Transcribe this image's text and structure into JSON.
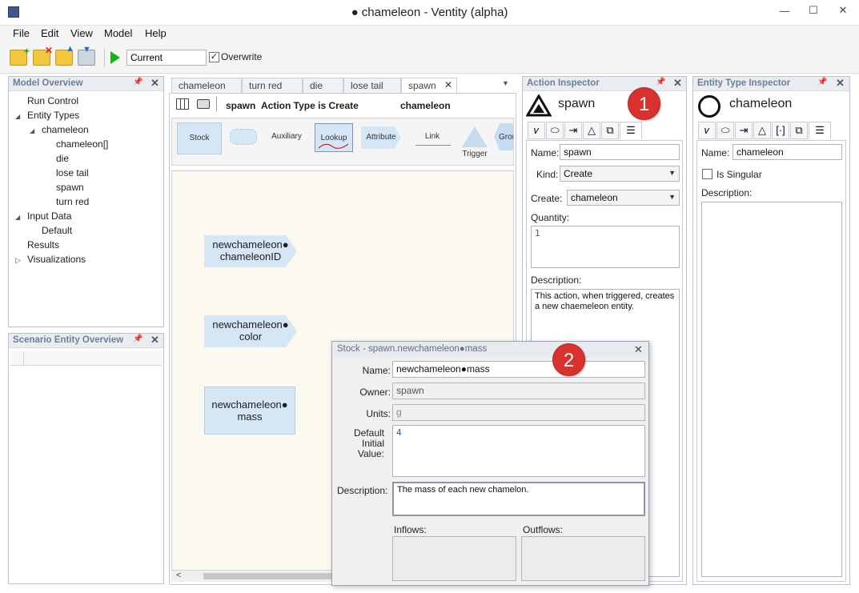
{
  "window": {
    "title": "● chameleon - Ventity (alpha)",
    "min_glyph": "—",
    "max_glyph": "☐",
    "close_glyph": "✕"
  },
  "menu": [
    "File",
    "Edit",
    "View",
    "Model",
    "Help"
  ],
  "toolbar": {
    "scenario_value": "Current",
    "overwrite_label": "Overwrite",
    "overwrite_checked": true
  },
  "model_overview": {
    "title": "Model Overview",
    "tree": {
      "run_control": "Run Control",
      "entity_types": "Entity Types",
      "chameleon": "chameleon",
      "chameleon_collection": "chameleon[]",
      "die": "die",
      "lose_tail": "lose tail",
      "spawn": "spawn",
      "turn_red": "turn red",
      "input_data": "Input Data",
      "default": "Default",
      "results": "Results",
      "visualizations": "Visualizations"
    }
  },
  "scenario_overview": {
    "title": "Scenario Entity Overview"
  },
  "editor": {
    "tabs": [
      "chameleon",
      "turn red",
      "die",
      "lose tail",
      "spawn"
    ],
    "active_tab": "spawn",
    "header_name": "spawn",
    "header_desc": "Action Type is Create",
    "header_target": "chameleon",
    "palette": [
      "Stock",
      "Auxiliary",
      "Lookup",
      "Attribute",
      "Link",
      "Trigger",
      "Grou"
    ],
    "nodes": {
      "n1": "newchameleon● chameleonID",
      "n2": "newchameleon● color",
      "n3": "newchameleon● mass"
    }
  },
  "action_inspector": {
    "title": "Action Inspector",
    "name_heading": "spawn",
    "name_label": "Name:",
    "name_value": "spawn",
    "kind_label": "Kind:",
    "kind_value": "Create",
    "create_label": "Create:",
    "create_value": "chameleon",
    "quantity_label": "Quantity:",
    "quantity_value": "1",
    "description_label": "Description:",
    "description_value": "This action, when triggered, creates a new chaemeleon entity."
  },
  "entity_inspector": {
    "title": "Entity Type Inspector",
    "name_heading": "chameleon",
    "name_label": "Name:",
    "name_value": "chameleon",
    "singular_label": "Is Singular",
    "description_label": "Description:"
  },
  "stock_dialog": {
    "title": "Stock - spawn.newchameleon●mass",
    "name_label": "Name:",
    "name_value": "newchameleon●mass",
    "owner_label": "Owner:",
    "owner_value": "spawn",
    "units_label": "Units:",
    "units_value": "g",
    "initial_label": "Default Initial Value:",
    "initial_value": "4",
    "description_label": "Description:",
    "description_value": "The mass of each new chamelon.",
    "inflows_label": "Inflows:",
    "outflows_label": "Outflows:"
  },
  "callouts": [
    "1",
    "2"
  ],
  "icons": {
    "pin": "pin-icon",
    "close": "close-icon",
    "play": "play-icon",
    "folder": "folder-icon"
  },
  "colors": {
    "callout": "#d9322e",
    "stock_fill": "#d5e7f7",
    "canvas": "#fcf9f0",
    "panel_header_text": "#6d7f96"
  }
}
